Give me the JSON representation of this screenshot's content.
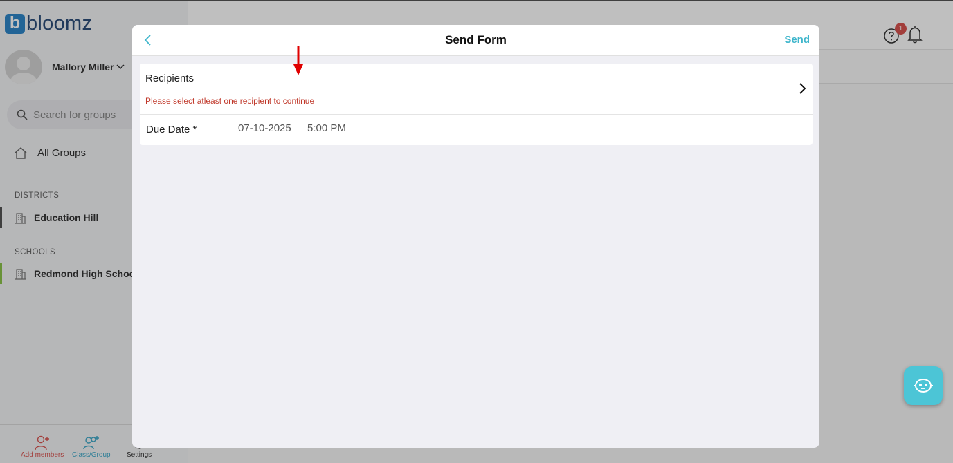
{
  "app": {
    "logo_letter": "b",
    "logo_text": "bloomz"
  },
  "user": {
    "name": "Mallory Miller"
  },
  "search": {
    "placeholder": "Search for groups"
  },
  "nav": {
    "all_groups": "All Groups"
  },
  "sections": [
    {
      "label": "DISTRICTS",
      "items": [
        {
          "label": "Education Hill",
          "accent": "#555555"
        }
      ]
    },
    {
      "label": "SCHOOLS",
      "items": [
        {
          "label": "Redmond High School",
          "accent": "#8bc34a"
        }
      ]
    }
  ],
  "bottom_bar": [
    {
      "label": "Add members",
      "color": "#d9534f",
      "icon": "add-member-icon"
    },
    {
      "label": "Class/Group",
      "color": "#3fa9c9",
      "icon": "add-group-icon"
    },
    {
      "label": "Settings",
      "color": "#333333",
      "icon": "gear-icon"
    }
  ],
  "header": {
    "notification_count": "1"
  },
  "modal": {
    "title": "Send Form",
    "send_label": "Send",
    "recipients": {
      "label": "Recipients",
      "error": "Please select atleast one recipient to continue"
    },
    "due": {
      "label": "Due Date *",
      "date": "07-10-2025",
      "time": "5:00 PM"
    }
  },
  "colors": {
    "accent": "#3fb6cc",
    "error": "#c0392b",
    "annotation": "#e00000",
    "brand": "#2e86c9"
  }
}
